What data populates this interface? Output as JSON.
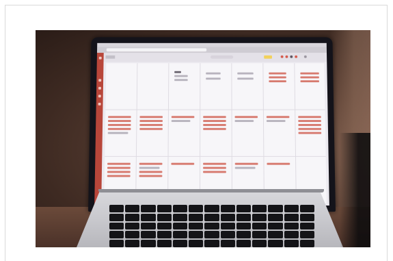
{
  "photo": {
    "subject": "laptop-on-desk",
    "palette": {
      "background": "#4a332a",
      "screen": "#eceaf0",
      "app_accent": "#b8463a",
      "entry_red": "#d77a6f",
      "highlight_yellow": "#f2d15c",
      "laptop_body": "#c9c9ce",
      "keys": "#141417"
    },
    "icons": [
      "laptop-screen-icon",
      "calendar-grid-icon",
      "keyboard-icon"
    ]
  }
}
